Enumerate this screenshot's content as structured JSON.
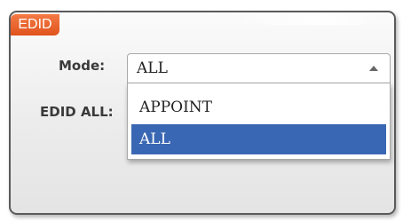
{
  "panel": {
    "tab_title": "EDID"
  },
  "form": {
    "mode_label": "Mode:",
    "edid_all_label": "EDID ALL:"
  },
  "mode_select": {
    "selected_value": "ALL",
    "options": [
      {
        "label": "APPOINT",
        "highlighted": false
      },
      {
        "label": "ALL",
        "highlighted": true
      }
    ],
    "highlight_color": "#3a67b3"
  },
  "colors": {
    "tab_accent": "#e0531c",
    "panel_border": "#5a5a5a"
  },
  "icons": {
    "select_arrow": "chevron-up-icon"
  }
}
